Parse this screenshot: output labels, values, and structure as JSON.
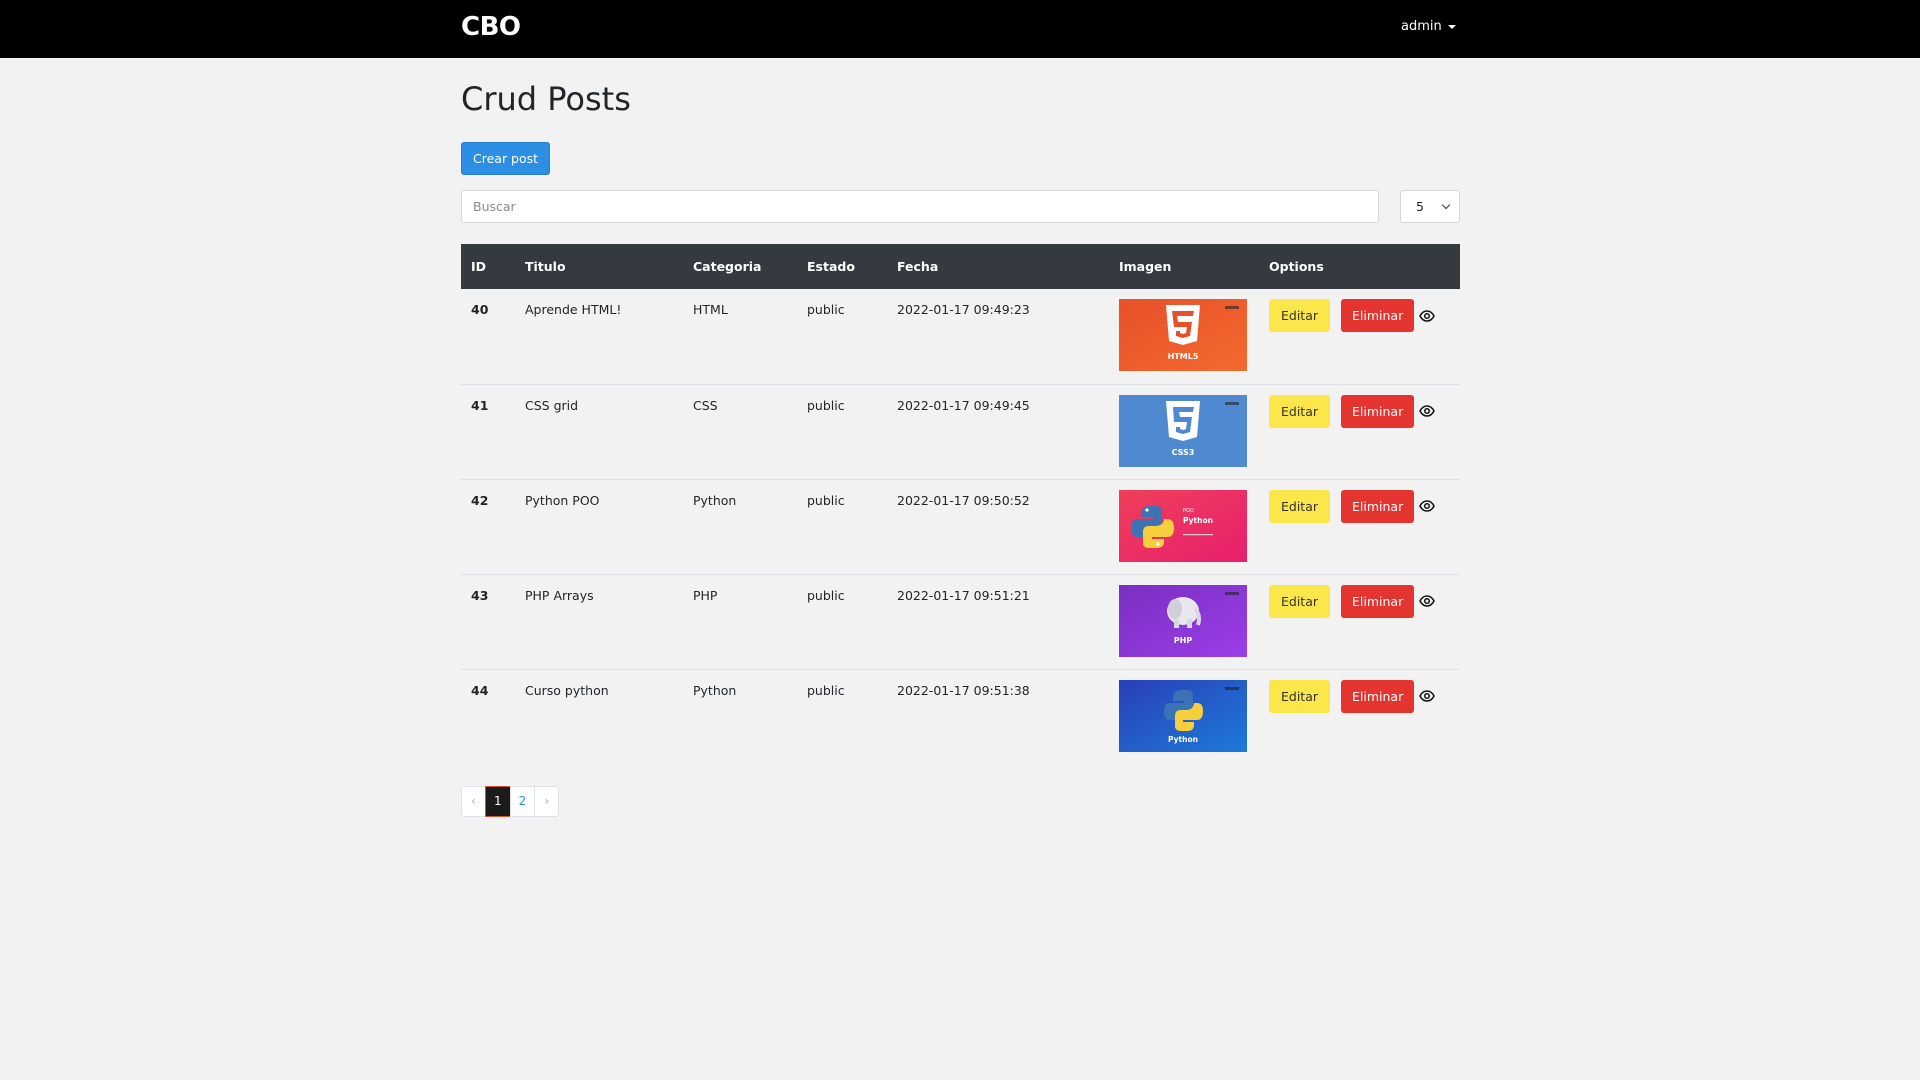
{
  "navbar": {
    "brand": "CBO",
    "user": "admin"
  },
  "page": {
    "title": "Crud Posts",
    "create_label": "Crear post"
  },
  "search": {
    "placeholder": "Buscar",
    "per_page": "5"
  },
  "table": {
    "headers": {
      "id": "ID",
      "title": "Titulo",
      "category": "Categoria",
      "state": "Estado",
      "date": "Fecha",
      "image": "Imagen",
      "options": "Options"
    },
    "rows": [
      {
        "id": "40",
        "title": "Aprende HTML!",
        "category": "HTML",
        "state": "public",
        "date": "2022-01-17 09:49:23",
        "image_label": "HTML5",
        "edit": "Editar",
        "delete": "Eliminar"
      },
      {
        "id": "41",
        "title": "CSS grid",
        "category": "CSS",
        "state": "public",
        "date": "2022-01-17 09:49:45",
        "image_label": "CSS3",
        "edit": "Editar",
        "delete": "Eliminar"
      },
      {
        "id": "42",
        "title": "Python POO",
        "category": "Python",
        "state": "public",
        "date": "2022-01-17 09:50:52",
        "image_label": "Python",
        "edit": "Editar",
        "delete": "Eliminar"
      },
      {
        "id": "43",
        "title": "PHP Arrays",
        "category": "PHP",
        "state": "public",
        "date": "2022-01-17 09:51:21",
        "image_label": "PHP",
        "edit": "Editar",
        "delete": "Eliminar"
      },
      {
        "id": "44",
        "title": "Curso python",
        "category": "Python",
        "state": "public",
        "date": "2022-01-17 09:51:38",
        "image_label": "Python",
        "edit": "Editar",
        "delete": "Eliminar"
      }
    ]
  },
  "pagination": {
    "prev": "‹",
    "pages": [
      "1",
      "2"
    ],
    "next": "›",
    "active": "1"
  },
  "colors": {
    "navbar": "#000000",
    "primary": "#2c8fe3",
    "edit": "#fce74b",
    "delete": "#e3342f",
    "table_head": "#343a40"
  },
  "icons": {
    "view": "eye-icon"
  }
}
